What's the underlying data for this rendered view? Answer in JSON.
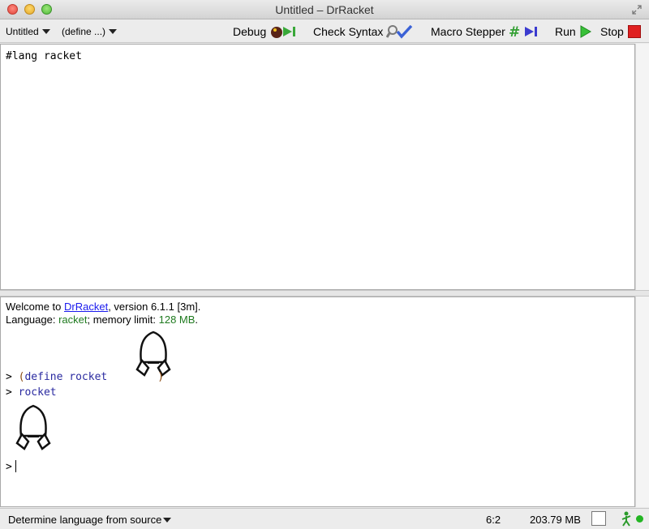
{
  "window": {
    "title": "Untitled – DrRacket"
  },
  "toolbar": {
    "file_menu": "Untitled",
    "define_menu": "(define ...)",
    "debug": "Debug",
    "check_syntax": "Check Syntax",
    "macro_stepper": "Macro Stepper",
    "run": "Run",
    "stop": "Stop"
  },
  "editor": {
    "code": "#lang racket"
  },
  "repl": {
    "welcome_prefix": "Welcome to ",
    "welcome_link": "DrRacket",
    "welcome_suffix": ", version 6.1.1 [3m].",
    "lang_prefix": "Language: ",
    "lang_name": "racket",
    "lang_middle": "; memory limit: ",
    "mem_limit": "128 MB",
    "lang_end": ".",
    "prompt": ">",
    "define_open": "(",
    "define_kw": "define",
    "define_name": "rocket",
    "define_close": ")",
    "expr": "rocket"
  },
  "status": {
    "language_select": "Determine language from source",
    "position": "6:2",
    "memory": "203.79 MB"
  },
  "colors": {
    "running_indicator": "#23b523",
    "stop": "#e02020",
    "run": "#38c038"
  }
}
